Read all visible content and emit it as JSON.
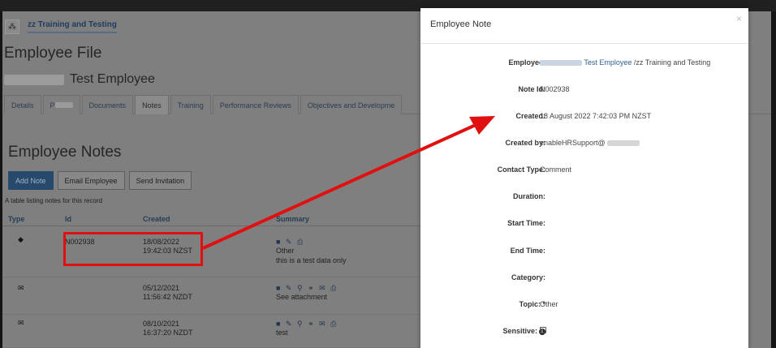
{
  "breadcrumb": {
    "org_icon": "sitemap-icon",
    "org_label": "zz Training and Testing"
  },
  "page": {
    "title": "Employee File",
    "employee_name": "Test Employee",
    "tabs": [
      {
        "label": "Details"
      },
      {
        "label": "P"
      },
      {
        "label": "Documents"
      },
      {
        "label": "Notes",
        "active": true
      },
      {
        "label": "Training"
      },
      {
        "label": "Performance Reviews"
      },
      {
        "label": "Objectives and Developme"
      }
    ],
    "section_title": "Employee Notes",
    "buttons": {
      "add_note": "Add Note",
      "email_employee": "Email Employee",
      "send_invitation": "Send Invitation"
    },
    "caption": "A table listing notes for this record"
  },
  "table": {
    "headers": {
      "type": "Type",
      "id": "Id",
      "created": "Created",
      "summary": "Summary"
    },
    "rows": [
      {
        "type_icon": "tag-icon",
        "type_glyph": "◆",
        "id": "N002938",
        "date": "18/08/2022",
        "time": "19:42:03 NZST",
        "actions": "■ ✎ ⎙",
        "summary_line1": "Other",
        "summary_line2": "this is a test data only"
      },
      {
        "type_icon": "envelope-icon",
        "type_glyph": "✉",
        "id": "",
        "date": "05/12/2021",
        "time": "11:56:42 NZDT",
        "actions": "■ ✎ ⚲ ⚭ ✉ ⎙",
        "summary_line1": "See attachment",
        "summary_line2": ""
      },
      {
        "type_icon": "envelope-icon",
        "type_glyph": "✉",
        "id": "",
        "date": "08/10/2021",
        "time": "16:37:20 NZDT",
        "actions": "■ ✎ ⚲ ⚭ ✉ ⎙",
        "summary_line1": "test",
        "summary_line2": ""
      }
    ]
  },
  "modal": {
    "title": "Employee Note",
    "close": "×",
    "employee_label": "Employee:",
    "employee_name": "Test Employee",
    "employee_org": "/zz Training and Testing",
    "note_id_label": "Note Id:",
    "note_id": "N002938",
    "created_label": "Created:",
    "created": "18 August 2022 7:42:03 PM NZST",
    "created_by_label": "Created by:",
    "created_by": "enableHRSupport@",
    "contact_type_label": "Contact Type:",
    "contact_type": "Comment",
    "duration_label": "Duration:",
    "start_time_label": "Start Time:",
    "end_time_label": "End Time:",
    "category_label": "Category:",
    "topic_label": "Topic: *",
    "topic": "Other",
    "sensitive_label": "Sensitive:",
    "sensitive_info": "i"
  },
  "colors": {
    "highlight": "#e01010",
    "primary_button": "#274a6c",
    "link": "#2f5f92"
  }
}
